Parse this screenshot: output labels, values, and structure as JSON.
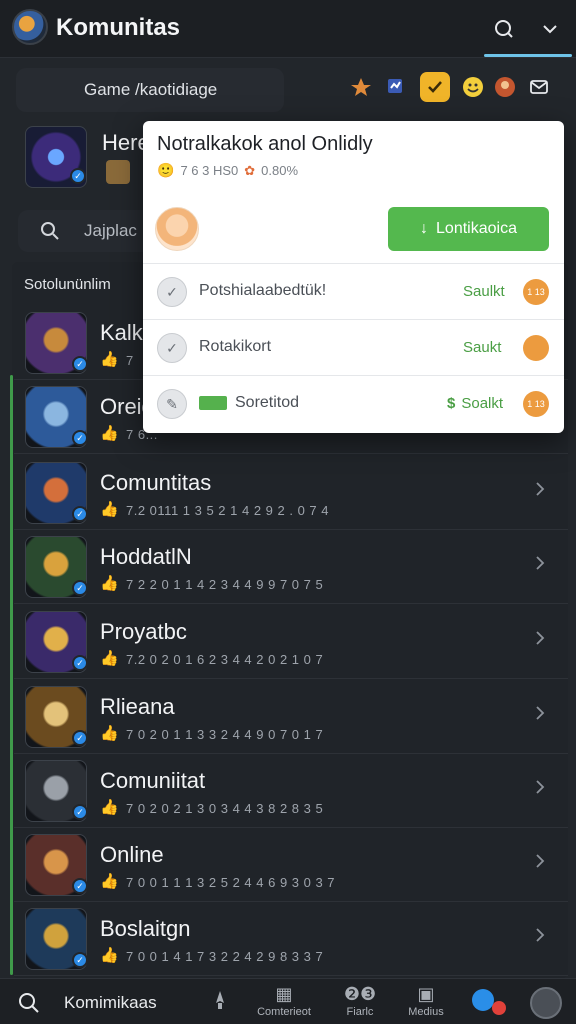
{
  "header": {
    "title": "Komunitas"
  },
  "filter": {
    "label": "Game /kaotidiage"
  },
  "featured": {
    "name": "Here"
  },
  "search": {
    "placeholder": "Jajplac"
  },
  "section": {
    "title": "Sotolunünlim"
  },
  "list": [
    {
      "name": "Kalk",
      "meta": "7 ",
      "thumb_colors": [
        "#4b2f6e",
        "#c78a3c"
      ]
    },
    {
      "name": "Oreid",
      "meta": "7 6...",
      "thumb_colors": [
        "#2d5a9a",
        "#8bb6e0"
      ]
    },
    {
      "name": "Comuntitas",
      "meta": "7.2 0111 1 3 5 2 1 4 2 9 2 . 0 7 4",
      "thumb_colors": [
        "#1f3a6a",
        "#d46f3b"
      ]
    },
    {
      "name": "HoddatlN",
      "meta": "7 2 2 0 1 1 4 2 3 4 4 9 9 7 0 7 5",
      "thumb_colors": [
        "#2a4a2f",
        "#d9a23d"
      ]
    },
    {
      "name": "Proyatbc",
      "meta": "7.2 0 2 0 1 6 2 3 4 4 2 0 2 1 0 7",
      "thumb_colors": [
        "#3a2a6a",
        "#e1b04a"
      ]
    },
    {
      "name": "Rlieana",
      "meta": "7 0 2 0 1 1 3 3 2 4 4 9 0 7 0 1 7",
      "thumb_colors": [
        "#6b4b1f",
        "#e3c27a"
      ]
    },
    {
      "name": "Comuniitat",
      "meta": "7 0 2 0 2 1 3 0 3 4 4 3 8 2 8 3 5",
      "thumb_colors": [
        "#2b2f35",
        "#9aa0a8"
      ]
    },
    {
      "name": "Online",
      "meta": "7 0 0 1 1 1 3 2 5 2 4 4 6 9 3 0 3 7",
      "thumb_colors": [
        "#5a2f2a",
        "#d8954a"
      ]
    },
    {
      "name": "Boslaitgn",
      "meta": "7 0 0 1 4 1 7 3 2 2 4 2 9 8 3 3 7",
      "thumb_colors": [
        "#1e3a5a",
        "#d0a23d"
      ]
    }
  ],
  "popup": {
    "title": "Notralkakok anol Onlidly",
    "stats": "7 6 3 HS0",
    "stats2": "0.80%",
    "button_label": "Lontikaoica",
    "options": [
      {
        "label": "Potshialaabedtük!",
        "status": "Saulkt",
        "badge": "1 13"
      },
      {
        "label": "Rotakikort",
        "status": "Saukt",
        "badge": ""
      },
      {
        "label": "Soretitod",
        "status": "Soalkt",
        "badge": "1 13"
      }
    ]
  },
  "bottom_nav": {
    "main_label": "Komimikaas",
    "items": [
      {
        "label": "Comterieot"
      },
      {
        "label": "Fiarlc"
      },
      {
        "label": "Medius"
      }
    ]
  }
}
